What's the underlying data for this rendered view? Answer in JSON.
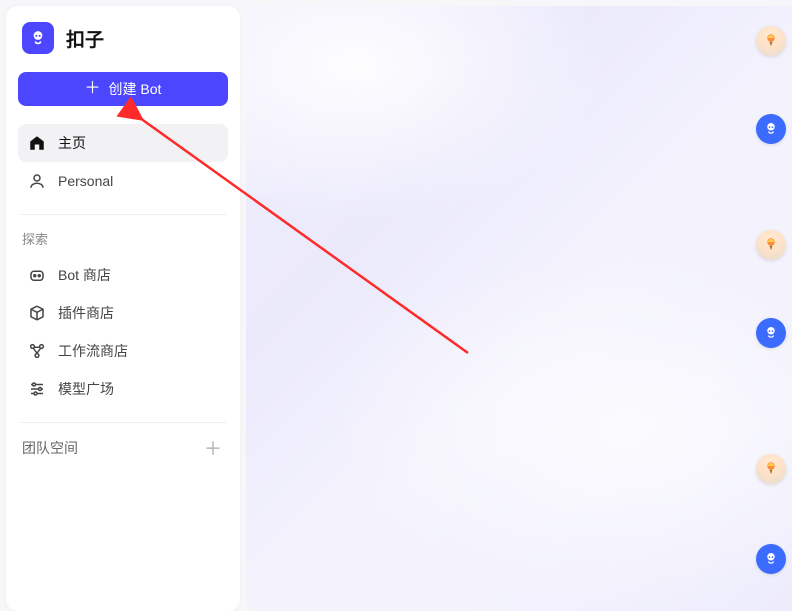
{
  "brand": {
    "name": "扣子"
  },
  "sidebar": {
    "create_label": "创建 Bot",
    "nav": [
      {
        "label": "主页",
        "icon": "home-icon",
        "active": true
      },
      {
        "label": "Personal",
        "icon": "user-icon",
        "active": false
      }
    ],
    "explore_header": "探索",
    "explore": [
      {
        "label": "Bot 商店",
        "icon": "bot-icon"
      },
      {
        "label": "插件商店",
        "icon": "cube-icon"
      },
      {
        "label": "工作流商店",
        "icon": "flow-icon"
      },
      {
        "label": "模型广场",
        "icon": "tune-icon"
      }
    ],
    "team_header": "团队空间"
  },
  "rail": {
    "items": [
      {
        "kind": "balloon"
      },
      {
        "kind": "bot"
      },
      {
        "kind": "balloon"
      },
      {
        "kind": "bot"
      },
      {
        "kind": "balloon"
      },
      {
        "kind": "bot"
      }
    ]
  },
  "annotation": {
    "arrow_color": "#ff2a2a"
  }
}
